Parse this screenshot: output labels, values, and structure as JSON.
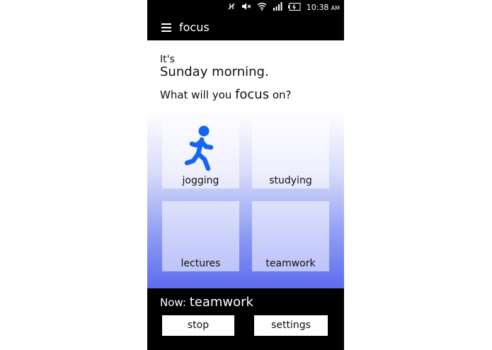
{
  "status": {
    "time": "10:38",
    "meridiem": "AM",
    "icons": [
      "data-off-icon",
      "mute-icon",
      "wifi-icon",
      "signal-icon",
      "battery-icon"
    ]
  },
  "app_bar": {
    "title": "focus"
  },
  "greeting": {
    "prefix": "It's",
    "day_time": "Sunday morning.",
    "question_before": "What will you ",
    "question_emph": "focus",
    "question_after": " on?"
  },
  "tiles": [
    {
      "label": "jogging",
      "icon": "runner-icon"
    },
    {
      "label": "studying"
    },
    {
      "label": "lectures"
    },
    {
      "label": "teamwork"
    }
  ],
  "now": {
    "prefix": "Now:",
    "activity": "teamwork"
  },
  "buttons": {
    "stop": "stop",
    "settings": "settings"
  },
  "colors": {
    "accent": "#1565f0",
    "gradient_end": "#5b6cf0",
    "bar": "#000000"
  }
}
